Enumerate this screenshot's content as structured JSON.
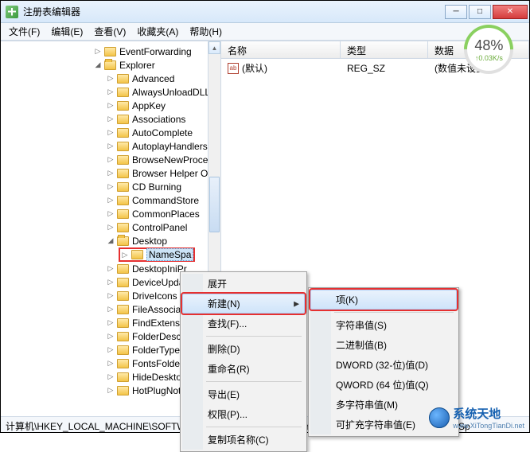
{
  "window": {
    "title": "注册表编辑器"
  },
  "menus": {
    "file": "文件(F)",
    "edit": "编辑(E)",
    "view": "查看(V)",
    "favorites": "收藏夹(A)",
    "help": "帮助(H)"
  },
  "speed": {
    "pct": "48%",
    "rate": "↑0.03K/s"
  },
  "tree": {
    "top1": "EventForwarding",
    "explorer": "Explorer",
    "items": [
      "Advanced",
      "AlwaysUnloadDLL",
      "AppKey",
      "Associations",
      "AutoComplete",
      "AutoplayHandlers",
      "BrowseNewProcess",
      "Browser Helper Ob",
      "CD Burning",
      "CommandStore",
      "CommonPlaces",
      "ControlPanel",
      "Desktop"
    ],
    "namespace": "NameSpa",
    "after": [
      "DesktopIniPr",
      "DeviceUpdat",
      "DriveIcons",
      "FileAssociatio",
      "FindExtension",
      "FolderDescri",
      "FolderTypes",
      "FontsFolder",
      "HideDesktop",
      "HotPlugNotification"
    ]
  },
  "list": {
    "col_name": "名称",
    "col_type": "类型",
    "col_data": "数据",
    "row_name": "(默认)",
    "row_type": "REG_SZ",
    "row_data": "(数值未设置)"
  },
  "ctx1": {
    "expand": "展开",
    "new": "新建(N)",
    "find": "查找(F)...",
    "delete": "删除(D)",
    "rename": "重命名(R)",
    "export": "导出(E)",
    "perm": "权限(P)...",
    "copykey": "复制项名称(C)"
  },
  "ctx2": {
    "key": "项(K)",
    "string": "字符串值(S)",
    "binary": "二进制值(B)",
    "dword": "DWORD (32-位)值(D)",
    "qword": "QWORD (64 位)值(Q)",
    "multi": "多字符串值(M)",
    "expand": "可扩充字符串值(E)"
  },
  "status": "计算机\\HKEY_LOCAL_MACHINE\\SOFTWARE\\Microsoft\\Windows\\CurrentVersion\\Explorer\\Desktop\\NameSp",
  "watermark": {
    "t1": "系统天地",
    "t2": "www.XiTongTianDi.net"
  }
}
